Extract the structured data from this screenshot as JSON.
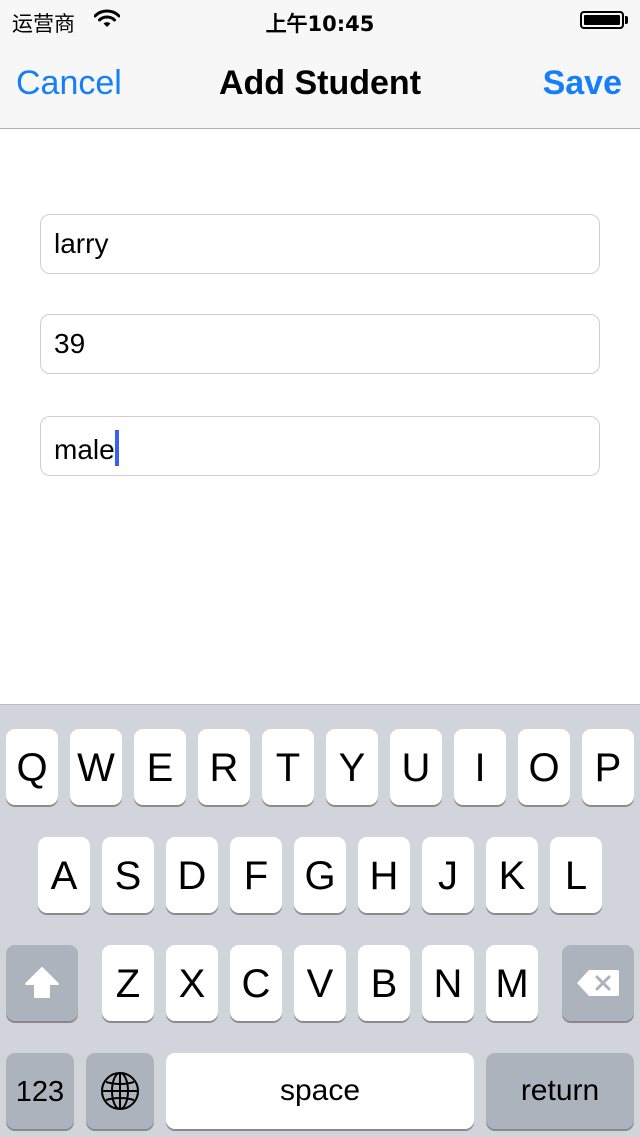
{
  "status_bar": {
    "carrier": "运营商",
    "time": "上午10:45",
    "icons": [
      "wifi-icon",
      "battery-icon"
    ]
  },
  "nav": {
    "cancel_label": "Cancel",
    "title": "Add Student",
    "save_label": "Save",
    "accent_color": "#157efb"
  },
  "form": {
    "fields": [
      {
        "value": "larry"
      },
      {
        "value": "39"
      },
      {
        "value": "male",
        "focused": true
      }
    ]
  },
  "keyboard": {
    "row1": [
      "Q",
      "W",
      "E",
      "R",
      "T",
      "Y",
      "U",
      "I",
      "O",
      "P"
    ],
    "row2": [
      "A",
      "S",
      "D",
      "F",
      "G",
      "H",
      "J",
      "K",
      "L"
    ],
    "row3": [
      "Z",
      "X",
      "C",
      "V",
      "B",
      "N",
      "M"
    ],
    "numbers_label": "123",
    "space_label": "space",
    "return_label": "return",
    "icons": [
      "shift-icon",
      "backspace-icon",
      "globe-icon"
    ]
  }
}
